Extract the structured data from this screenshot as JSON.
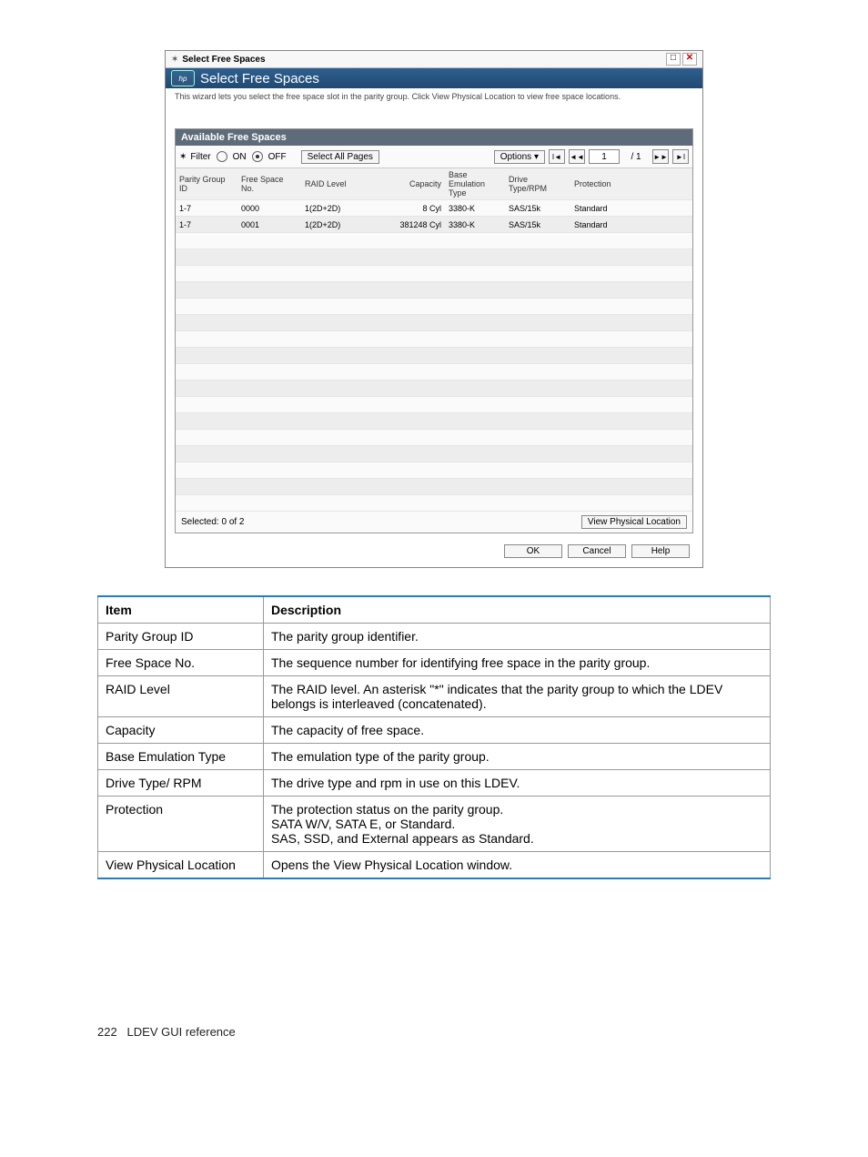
{
  "dialog": {
    "window_title": "Select Free Spaces",
    "header_title": "Select Free Spaces",
    "subtext": "This wizard lets you select the free space slot in the parity group. Click View Physical Location to view free space locations.",
    "panel_title": "Available Free Spaces",
    "toolbar": {
      "filter_label": "Filter",
      "radio_on": "ON",
      "radio_off": "OFF",
      "select_all_pages": "Select All Pages",
      "options": "Options",
      "page_current": "1",
      "page_total": "/ 1"
    },
    "columns": [
      "Parity Group ID",
      "Free Space No.",
      "RAID Level",
      "Capacity",
      "Base Emulation Type",
      "Drive Type/RPM",
      "Protection",
      ""
    ],
    "rows": [
      {
        "pg": "1-7",
        "fs": "0000",
        "raid": "1(2D+2D)",
        "cap": "8 Cyl",
        "emu": "3380-K",
        "drv": "SAS/15k",
        "prot": "Standard"
      },
      {
        "pg": "1-7",
        "fs": "0001",
        "raid": "1(2D+2D)",
        "cap": "381248 Cyl",
        "emu": "3380-K",
        "drv": "SAS/15k",
        "prot": "Standard"
      }
    ],
    "blank_rows": 17,
    "selected_label": "Selected:  0   of  2",
    "view_physical": "View Physical Location",
    "buttons": {
      "ok": "OK",
      "cancel": "Cancel",
      "help": "Help"
    }
  },
  "desc_table": {
    "head_item": "Item",
    "head_desc": "Description",
    "rows": [
      {
        "item": "Parity Group ID",
        "desc": "The parity group identifier."
      },
      {
        "item": "Free Space No.",
        "desc": "The sequence number for identifying free space in the parity group."
      },
      {
        "item": "RAID Level",
        "desc": "The RAID level. An asterisk \"*\" indicates that the parity group to which the LDEV belongs is interleaved (concatenated)."
      },
      {
        "item": "Capacity",
        "desc": "The capacity of free space."
      },
      {
        "item": "Base Emulation Type",
        "desc": "The emulation type of the parity group."
      },
      {
        "item": "Drive Type/ RPM",
        "desc": "The drive type and rpm in use on this LDEV."
      },
      {
        "item": "Protection",
        "desc": "The protection status on the parity group.\nSATA W/V, SATA E, or Standard.\nSAS, SSD, and External appears as Standard."
      },
      {
        "item": "View Physical Location",
        "desc": "Opens the View Physical Location window."
      }
    ]
  },
  "footer": {
    "page": "222",
    "section": "LDEV GUI reference"
  }
}
